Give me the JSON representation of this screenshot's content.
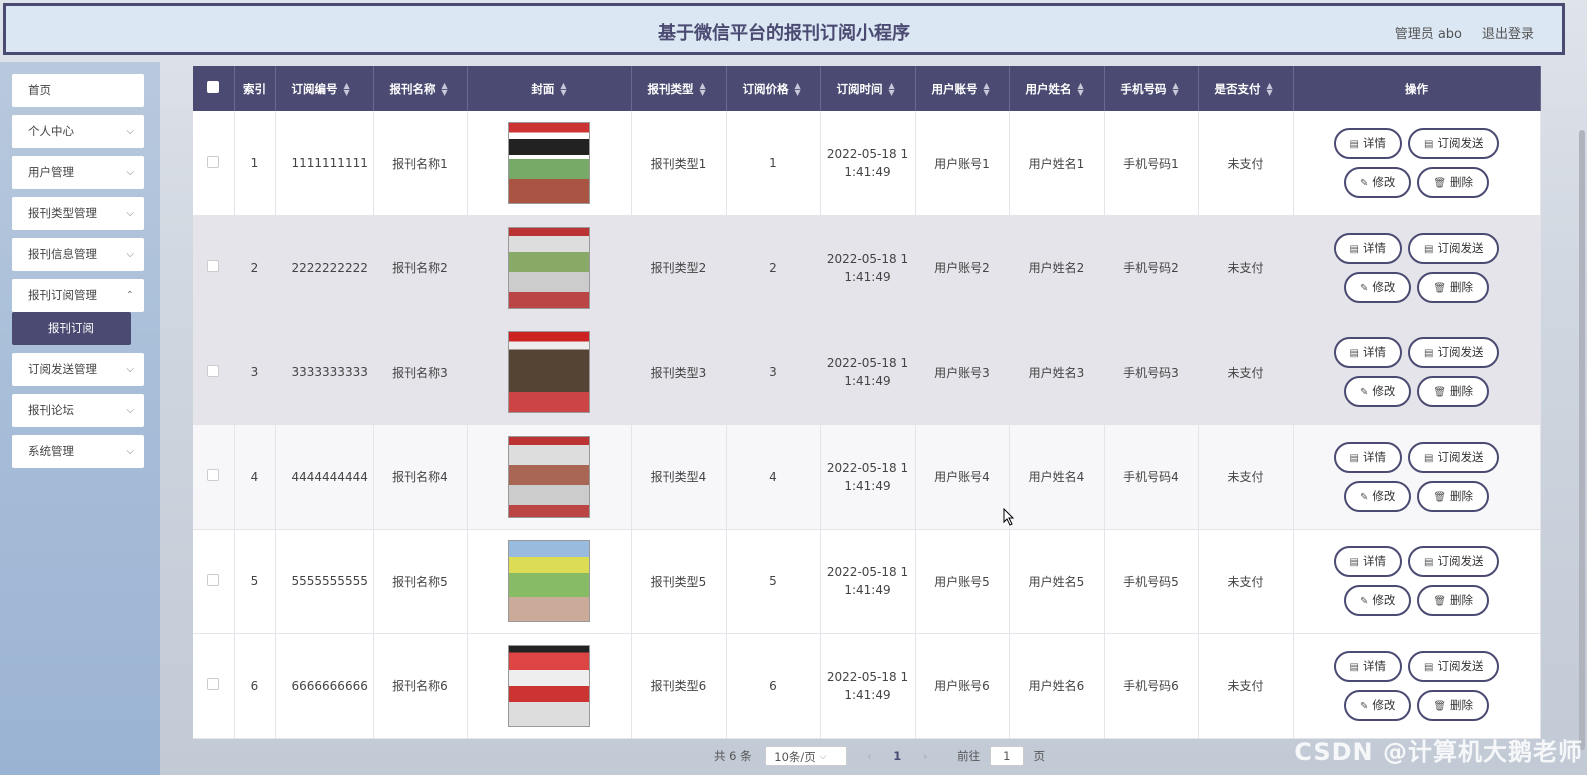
{
  "header": {
    "title": "基于微信平台的报刊订阅小程序",
    "user": "管理员 abo",
    "logout": "退出登录"
  },
  "sidebar": {
    "items": [
      {
        "label": "首页"
      },
      {
        "label": "个人中心"
      },
      {
        "label": "用户管理"
      },
      {
        "label": "报刊类型管理"
      },
      {
        "label": "报刊信息管理"
      },
      {
        "label": "报刊订阅管理"
      },
      {
        "label": "订阅发送管理"
      },
      {
        "label": "报刊论坛"
      },
      {
        "label": "系统管理"
      }
    ],
    "active_sub": "报刊订阅"
  },
  "table": {
    "headers": [
      "索引",
      "订阅编号",
      "报刊名称",
      "封面",
      "报刊类型",
      "订阅价格",
      "订阅时间",
      "用户账号",
      "用户姓名",
      "手机号码",
      "是否支付",
      "操作"
    ],
    "rows": [
      {
        "idx": "1",
        "no": "1111111111",
        "name": "报刊名称1",
        "type": "报刊类型1",
        "price": "1",
        "time1": "2022-05-18 1",
        "time2": "1:41:49",
        "account": "用户账号1",
        "uname": "用户姓名1",
        "phone": "手机号码1",
        "paid": "未支付"
      },
      {
        "idx": "2",
        "no": "2222222222",
        "name": "报刊名称2",
        "type": "报刊类型2",
        "price": "2",
        "time1": "2022-05-18 1",
        "time2": "1:41:49",
        "account": "用户账号2",
        "uname": "用户姓名2",
        "phone": "手机号码2",
        "paid": "未支付"
      },
      {
        "idx": "3",
        "no": "3333333333",
        "name": "报刊名称3",
        "type": "报刊类型3",
        "price": "3",
        "time1": "2022-05-18 1",
        "time2": "1:41:49",
        "account": "用户账号3",
        "uname": "用户姓名3",
        "phone": "手机号码3",
        "paid": "未支付"
      },
      {
        "idx": "4",
        "no": "4444444444",
        "name": "报刊名称4",
        "type": "报刊类型4",
        "price": "4",
        "time1": "2022-05-18 1",
        "time2": "1:41:49",
        "account": "用户账号4",
        "uname": "用户姓名4",
        "phone": "手机号码4",
        "paid": "未支付"
      },
      {
        "idx": "5",
        "no": "5555555555",
        "name": "报刊名称5",
        "type": "报刊类型5",
        "price": "5",
        "time1": "2022-05-18 1",
        "time2": "1:41:49",
        "account": "用户账号5",
        "uname": "用户姓名5",
        "phone": "手机号码5",
        "paid": "未支付"
      },
      {
        "idx": "6",
        "no": "6666666666",
        "name": "报刊名称6",
        "type": "报刊类型6",
        "price": "6",
        "time1": "2022-05-18 1",
        "time2": "1:41:49",
        "account": "用户账号6",
        "uname": "用户姓名6",
        "phone": "手机号码6",
        "paid": "未支付"
      }
    ],
    "actions": {
      "detail": "详情",
      "send": "订阅发送",
      "edit": "修改",
      "delete": "删除"
    }
  },
  "pager": {
    "total": "共 6 条",
    "per_page": "10条/页",
    "current": "1",
    "goto_label": "前往",
    "goto_value": "1",
    "page_suffix": "页"
  },
  "watermark": "CSDN @计算机大鹅老师",
  "colors": {
    "accent": "#4a4a72",
    "header_bg": "#dbe7f2"
  }
}
